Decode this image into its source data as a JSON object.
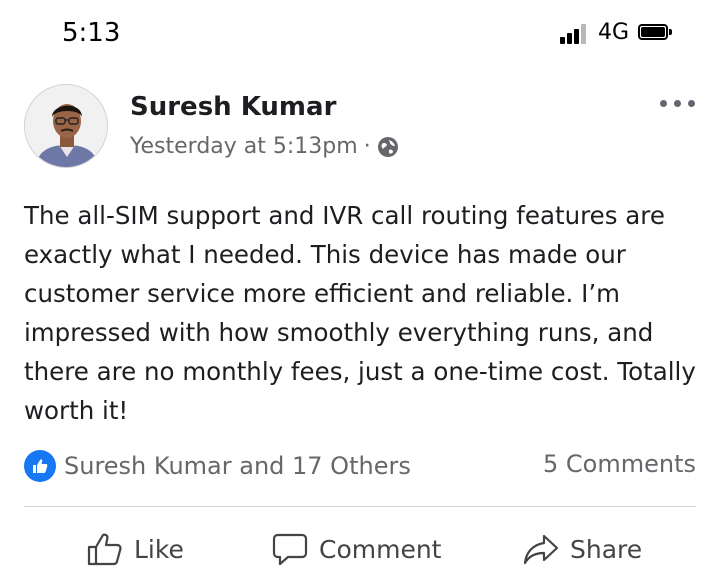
{
  "status_bar": {
    "time": "5:13",
    "network": "4G",
    "signal_bars_active": 3,
    "signal_bars_total": 4
  },
  "post": {
    "author": "Suresh Kumar",
    "timestamp": "Yesterday at 5:13pm",
    "separator": "·",
    "privacy_icon": "globe-icon",
    "more_icon": "more-options-icon",
    "text": "The all-SIM support and IVR call routing features are exactly what I needed. This device has made our customer service more efficient and reliable. I’m impressed with how smoothly everything runs, and there are no monthly fees, just a one-time cost. Totally worth it!",
    "reactions": "Suresh Kumar and 17 Others",
    "comments": "5 Comments"
  },
  "actions": {
    "like": "Like",
    "comment": "Comment",
    "share": "Share"
  },
  "colors": {
    "accent": "#1877f2",
    "secondary_text": "#65676b",
    "divider": "#ced0d4"
  }
}
